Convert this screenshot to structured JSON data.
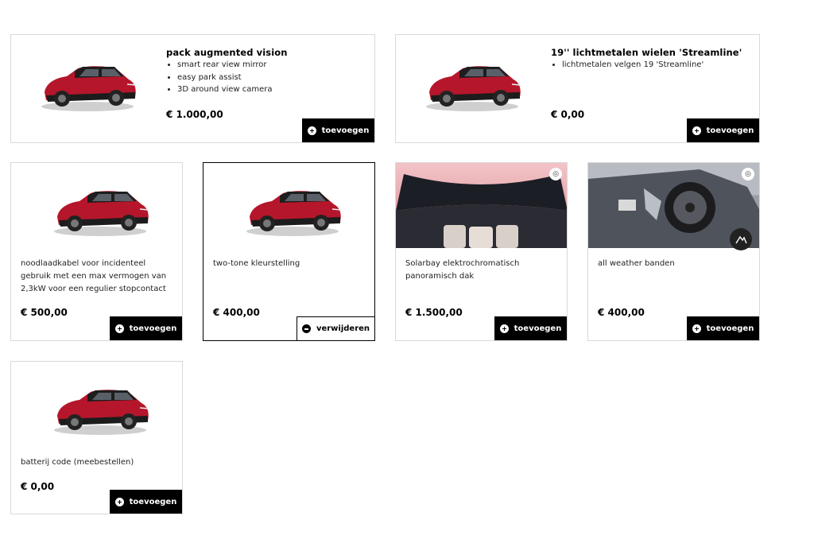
{
  "cards": {
    "pack": {
      "title": "pack augmented vision",
      "bullets": [
        "smart rear view mirror",
        "easy park assist",
        "3D around view camera"
      ],
      "price": "€ 1.000,00",
      "button": "toevoegen"
    },
    "wheels": {
      "title": "19'' lichtmetalen wielen 'Streamline'",
      "bullets": [
        "lichtmetalen velgen 19 'Streamline'"
      ],
      "price": "€ 0,00",
      "button": "toevoegen"
    },
    "cable": {
      "description": "noodlaadkabel voor incidenteel gebruik met een max vermogen van 2,3kW voor een regulier stopcontact",
      "price": "€ 500,00",
      "button": "toevoegen"
    },
    "twotone": {
      "description": "two-tone kleurstelling",
      "price": "€ 400,00",
      "button": "verwijderen"
    },
    "solarbay": {
      "description": "Solarbay elektrochromatisch panoramisch dak",
      "price": "€ 1.500,00",
      "button": "toevoegen"
    },
    "tires": {
      "description": "all weather banden",
      "price": "€ 400,00",
      "button": "toevoegen"
    },
    "battery": {
      "description": "batterij code (meebestellen)",
      "price": "€ 0,00",
      "button": "toevoegen"
    }
  },
  "colors": {
    "accent": "#000000",
    "car_body": "#b5162b",
    "border": "#d9d9d9"
  },
  "icons": {
    "add": "plus-circle-icon",
    "remove": "minus-circle-icon",
    "zoom": "zoom-icon",
    "media": "mountain-icon"
  }
}
